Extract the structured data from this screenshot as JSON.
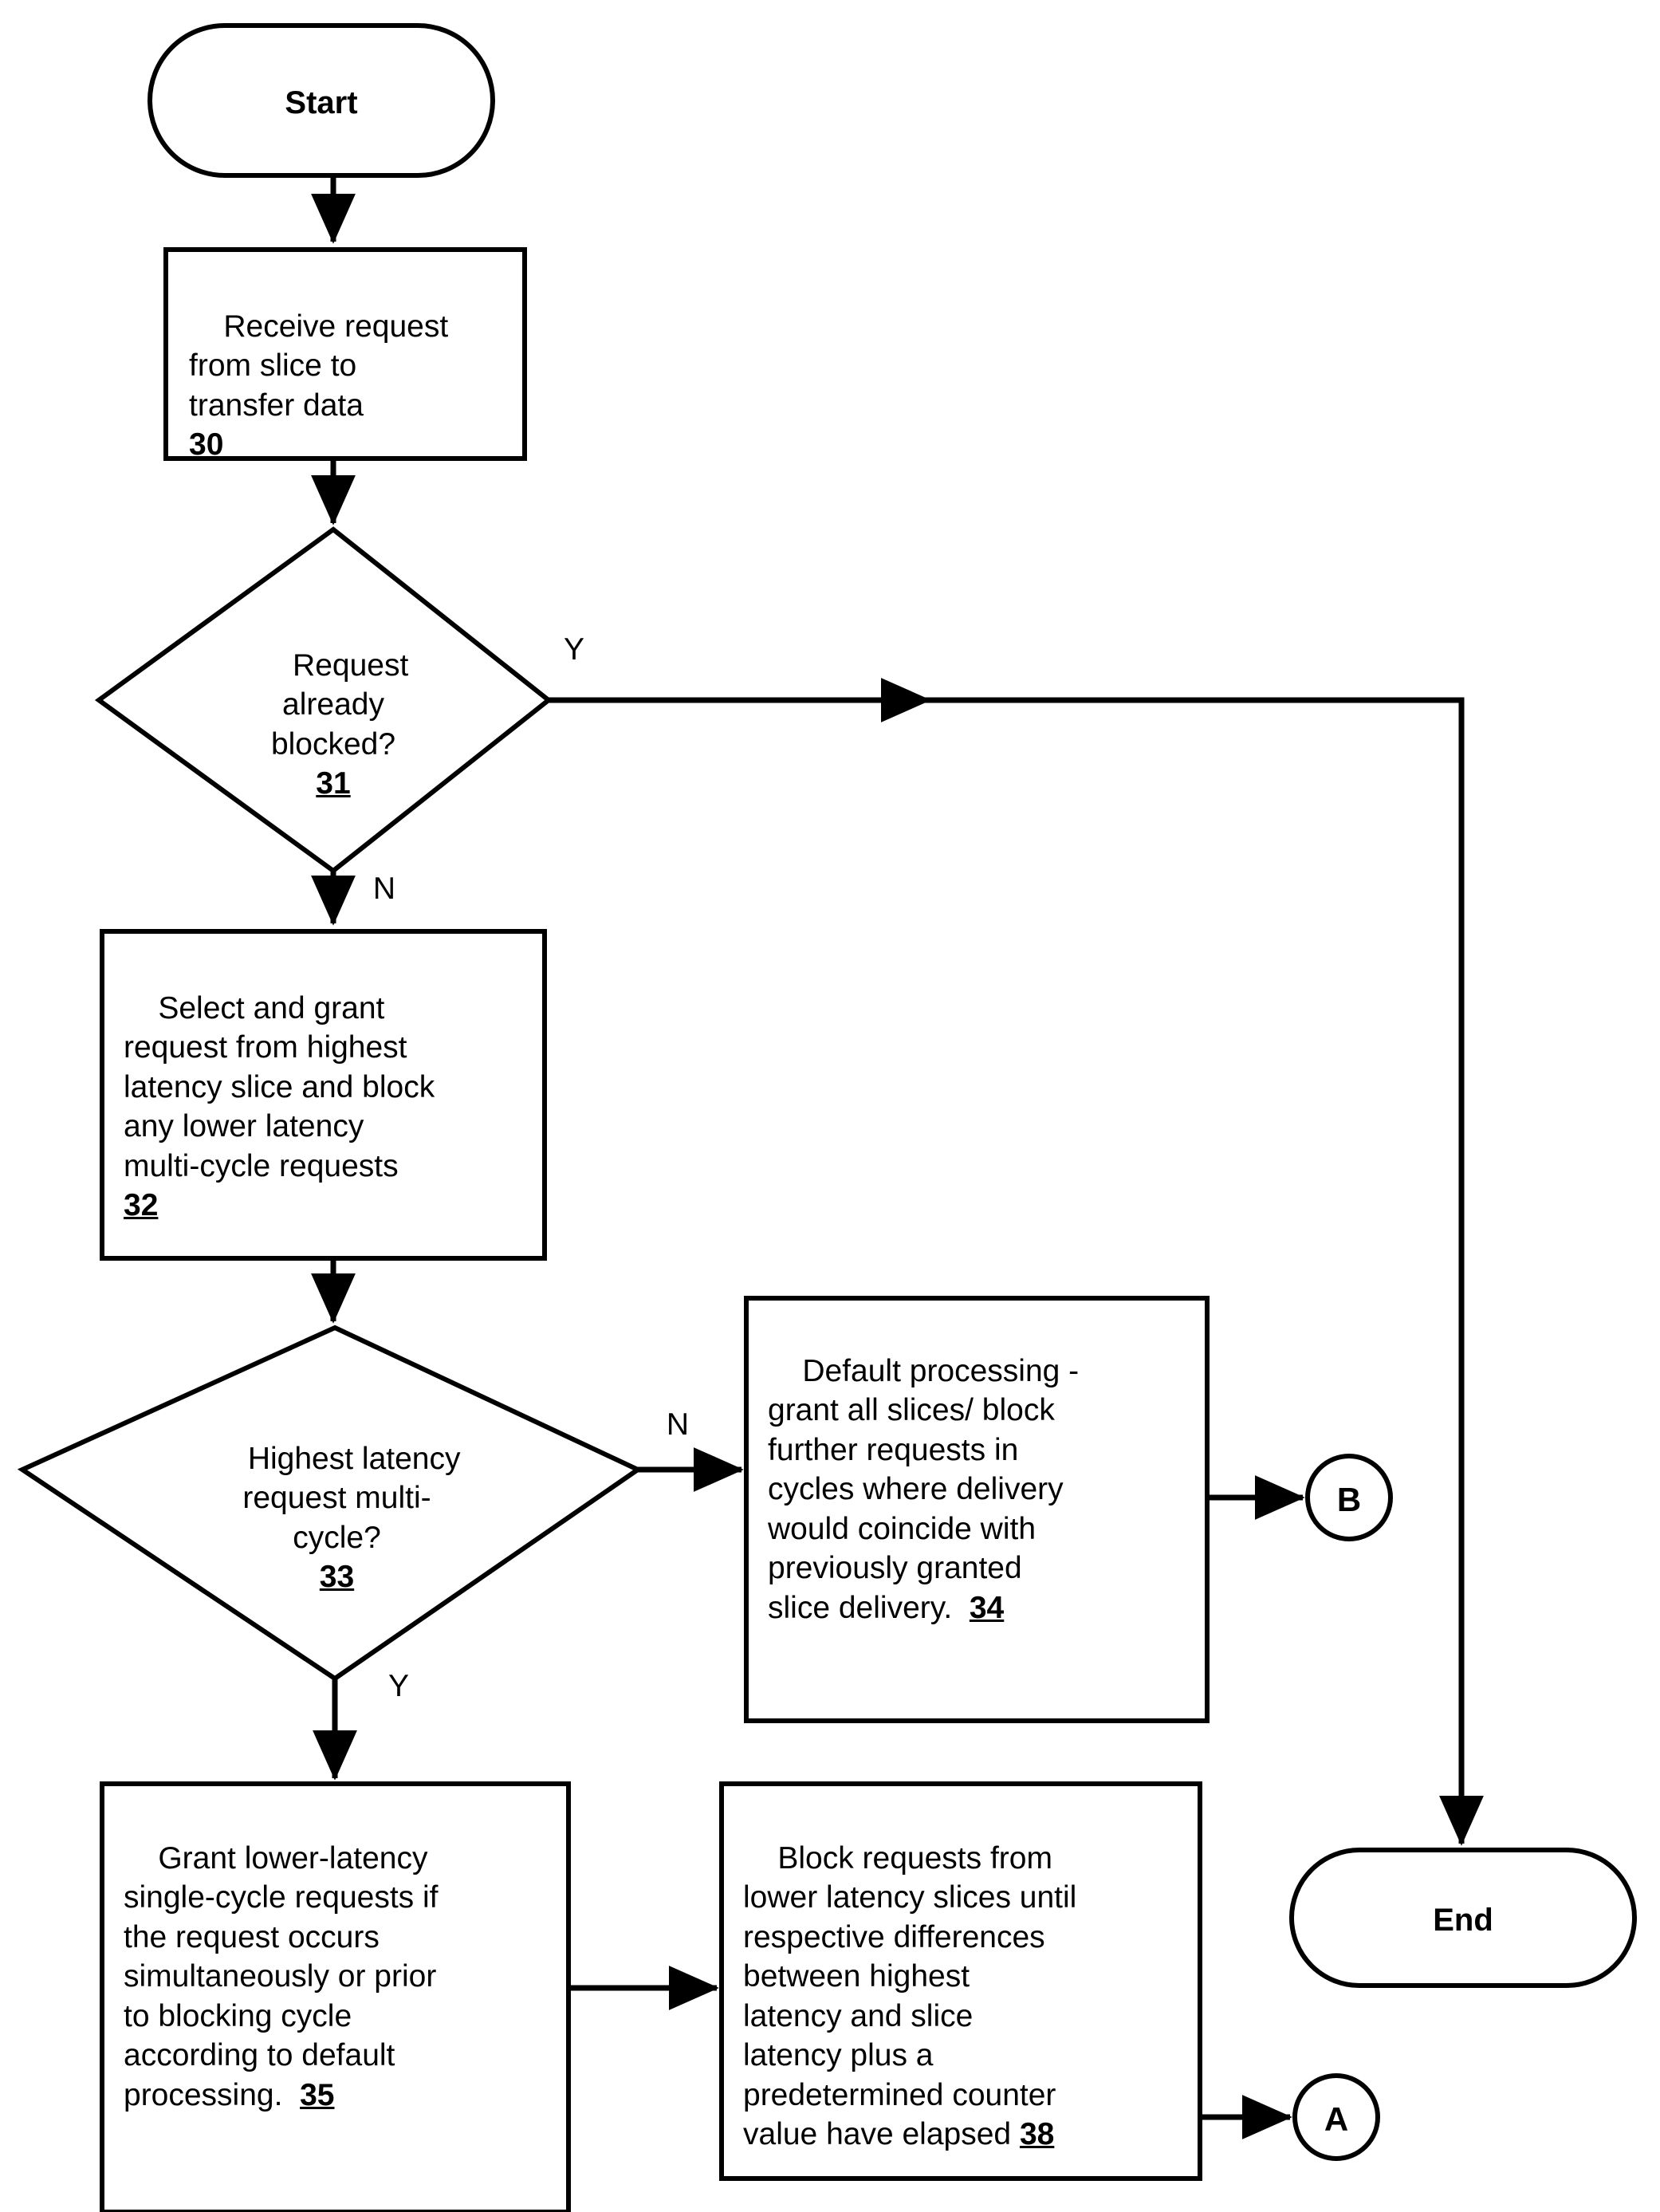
{
  "diagram": {
    "title": "Flowchart",
    "type": "flowchart",
    "stroke_color": "#000000",
    "background_color": "#ffffff"
  },
  "nodes": {
    "start": {
      "label": "Start",
      "shape": "terminator"
    },
    "receive_request": {
      "text": "Receive request\nfrom slice to\ntransfer data\n",
      "ref": "30",
      "shape": "process"
    },
    "request_blocked": {
      "text": "Request\nalready\nblocked?\n",
      "ref": "31",
      "shape": "decision"
    },
    "select_and_grant": {
      "text": "Select and grant\nrequest from highest\nlatency slice and block\nany lower latency\nmulti-cycle requests\n",
      "ref": "32",
      "shape": "process"
    },
    "highest_latency_multicycle": {
      "text": "Highest latency\nrequest multi-\ncycle?\n",
      "ref": "33",
      "shape": "decision"
    },
    "default_processing": {
      "text": "Default processing -\ngrant all slices/ block\nfurther requests in\ncycles where delivery\nwould coincide with\npreviously granted\nslice delivery.  ",
      "ref": "34",
      "shape": "process"
    },
    "grant_lower_latency": {
      "text": "Grant lower-latency\nsingle-cycle requests if\nthe request occurs\nsimultaneously or prior\nto blocking cycle\naccording to default\nprocessing.  ",
      "ref": "35",
      "shape": "process"
    },
    "block_requests": {
      "text": "Block requests from\nlower latency slices until\nrespective differences\nbetween highest\nlatency and slice\nlatency plus a\npredetermined counter\nvalue have elapsed ",
      "ref": "38",
      "shape": "process"
    },
    "connector_b": {
      "label": "B",
      "shape": "connector"
    },
    "connector_a": {
      "label": "A",
      "shape": "connector"
    },
    "end": {
      "label": "End",
      "shape": "terminator"
    }
  },
  "edges": {
    "start_to_receive": {
      "label": ""
    },
    "receive_to_decision31": {
      "label": ""
    },
    "decision31_yes": {
      "label": "Y"
    },
    "decision31_no": {
      "label": "N"
    },
    "select_to_decision33": {
      "label": ""
    },
    "decision33_no": {
      "label": "N"
    },
    "decision33_yes": {
      "label": "Y"
    },
    "default_to_b": {
      "label": ""
    },
    "grant35_to_block38": {
      "label": ""
    },
    "block38_to_a": {
      "label": ""
    },
    "yes_branch_to_end": {
      "label": ""
    }
  }
}
